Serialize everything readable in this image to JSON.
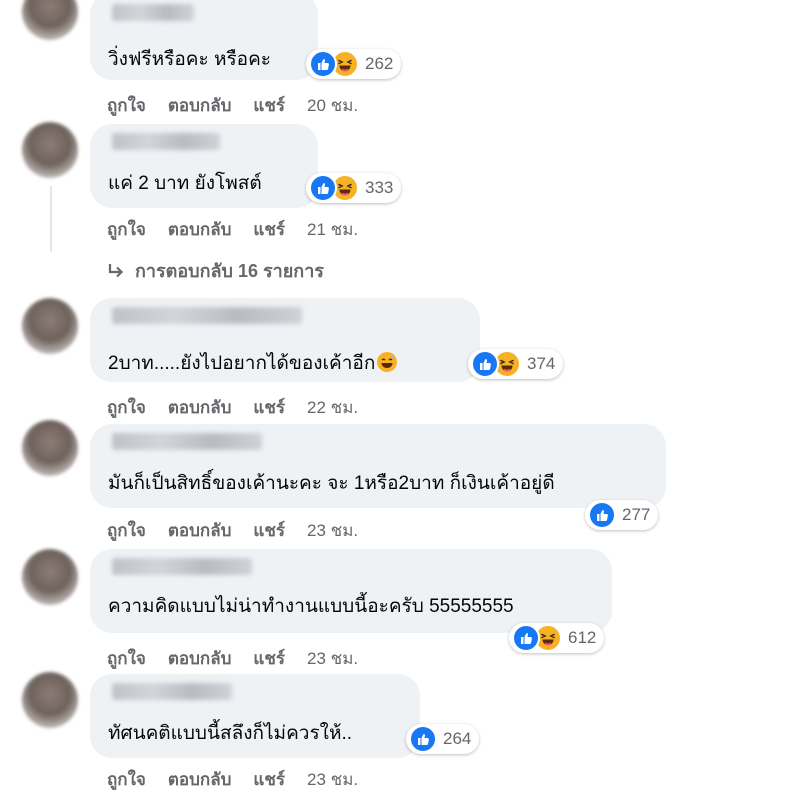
{
  "comments": [
    {
      "text": "วิ่งฟรีหรือคะ หรือคะ",
      "reaction_count": "262",
      "reactions": [
        "like",
        "haha"
      ],
      "actions": {
        "like": "ถูกใจ",
        "reply": "ตอบกลับ",
        "share": "แชร์",
        "time": "20 ชม."
      }
    },
    {
      "text": "แค่ 2 บาท ยังโพสต์",
      "reaction_count": "333",
      "reactions": [
        "like",
        "haha"
      ],
      "actions": {
        "like": "ถูกใจ",
        "reply": "ตอบกลับ",
        "share": "แชร์",
        "time": "21 ชม."
      },
      "replies_label": "การตอบกลับ 16 รายการ"
    },
    {
      "text": "2บาท.....ยังไปอยากได้ของเค้าอีก",
      "reaction_count": "374",
      "reactions": [
        "like",
        "haha"
      ],
      "actions": {
        "like": "ถูกใจ",
        "reply": "ตอบกลับ",
        "share": "แชร์",
        "time": "22 ชม."
      }
    },
    {
      "text": "มันก็เป็นสิทธิ์ของเค้านะคะ จะ 1หรือ2บาท ก็เงินเค้าอยู่ดี",
      "reaction_count": "277",
      "reactions": [
        "like"
      ],
      "actions": {
        "like": "ถูกใจ",
        "reply": "ตอบกลับ",
        "share": "แชร์",
        "time": "23 ชม."
      }
    },
    {
      "text": "ความคิดแบบไม่น่าทำงานแบบนี้อะครับ 55555555",
      "reaction_count": "612",
      "reactions": [
        "like",
        "haha"
      ],
      "actions": {
        "like": "ถูกใจ",
        "reply": "ตอบกลับ",
        "share": "แชร์",
        "time": "23 ชม."
      }
    },
    {
      "text": "ทัศนคติแบบนี้สลึงก็ไม่ควรให้..",
      "reaction_count": "264",
      "reactions": [
        "like"
      ],
      "actions": {
        "like": "ถูกใจ",
        "reply": "ตอบกลับ",
        "share": "แชร์",
        "time": "23 ชม."
      }
    }
  ],
  "colors": {
    "bubble": "#eff2f5",
    "like": "#1877f2",
    "haha": "#f7b125",
    "meta": "#65676b"
  }
}
